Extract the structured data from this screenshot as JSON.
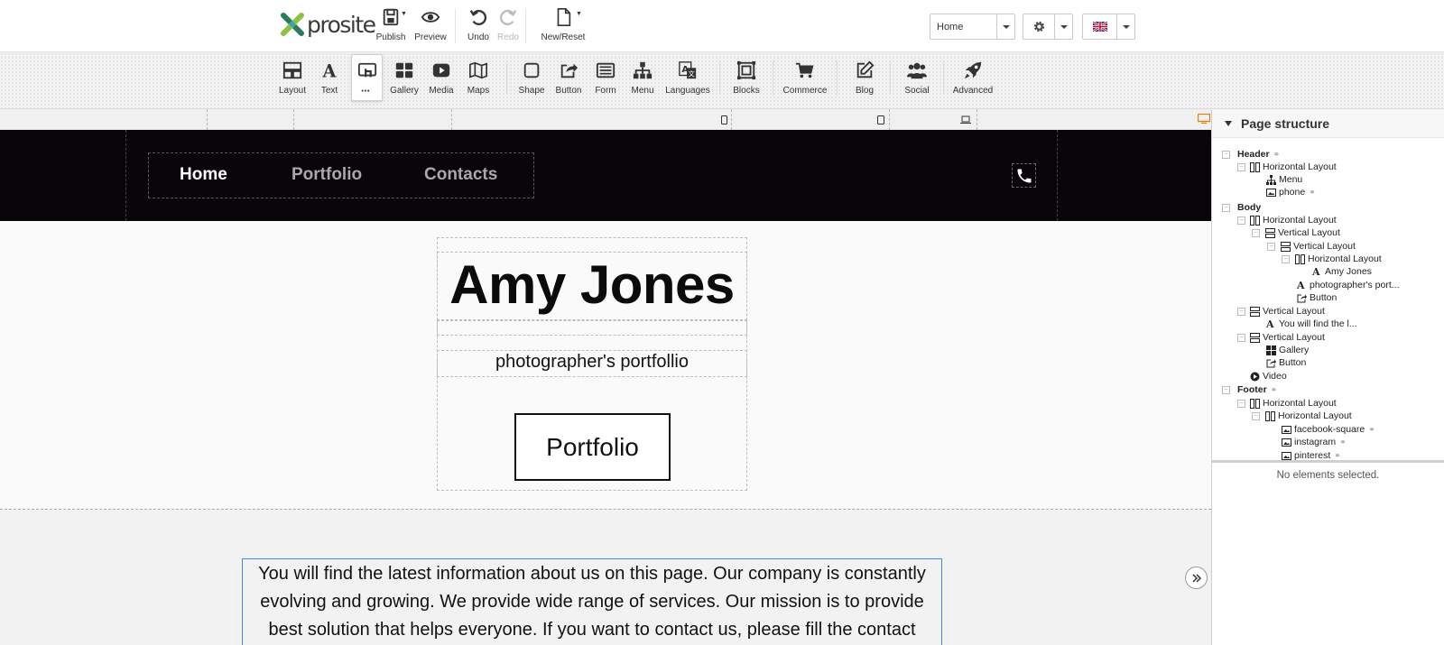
{
  "topbar": {
    "logo_text": "prosite",
    "publish": "Publish",
    "preview": "Preview",
    "undo": "Undo",
    "redo": "Redo",
    "new_reset": "New/Reset",
    "page_select": "Home",
    "flag": "UK flag"
  },
  "widgets": {
    "layout": "Layout",
    "text": "Text",
    "gallery": "Gallery",
    "media": "Media",
    "maps": "Maps",
    "shape": "Shape",
    "button": "Button",
    "form": "Form",
    "menu": "Menu",
    "languages": "Languages",
    "blocks": "Blocks",
    "commerce": "Commerce",
    "blog": "Blog",
    "social": "Social",
    "advanced": "Advanced"
  },
  "site": {
    "nav": [
      "Home",
      "Portfolio",
      "Contacts"
    ],
    "hero_title": "Amy Jones",
    "hero_subtitle": "photographer's portfollio",
    "hero_button": "Portfolio",
    "body_text": "You will find the latest information about us on this page. Our company is constantly evolving and growing. We provide wide range of services. Our mission is to provide best solution that helps everyone. If you want to contact us, please fill the contact"
  },
  "panel": {
    "title": "Page structure",
    "tree": {
      "header": "Header",
      "h_hl": "Horizontal Layout",
      "h_menu": "Menu",
      "h_phone": "phone",
      "body": "Body",
      "b_hl": "Horizontal Layout",
      "b_vl1": "Vertical Layout",
      "b_vl2": "Vertical Layout",
      "b_hl2": "Horizontal Layout",
      "b_amy": "Amy Jones",
      "b_photo": "photographer's port...",
      "b_button": "Button",
      "b_vl3": "Vertical Layout",
      "b_text": "You will find the l...",
      "b_vl4": "Vertical Layout",
      "b_gallery": "Gallery",
      "b_button2": "Button",
      "b_video": "Video",
      "footer": "Footer",
      "f_hl": "Horizontal Layout",
      "f_hl2": "Horizontal Layout",
      "f_fb": "facebook-square",
      "f_ig": "instagram",
      "f_pin": "pinterest"
    },
    "no_selection": "No elements selected."
  }
}
